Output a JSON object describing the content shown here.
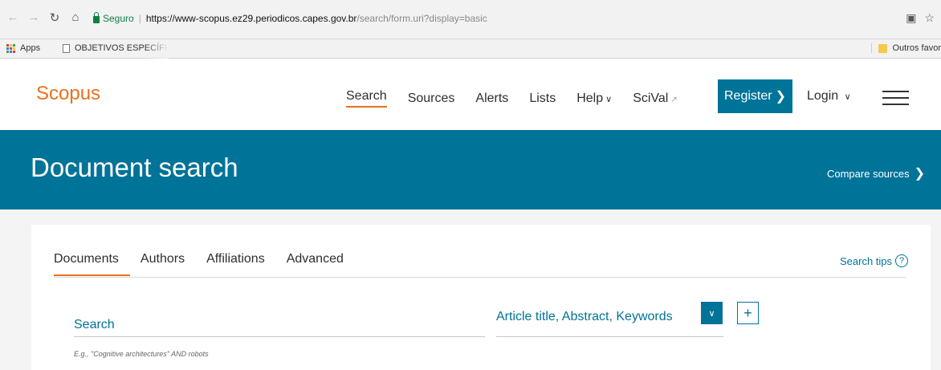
{
  "browser": {
    "secure_label": "Seguro",
    "url_host": "https://www-scopus.ez29.periodicos.capes.gov.br",
    "url_path": "/search/form.uri?display=basic",
    "bookmarks": {
      "apps": "Apps",
      "objetivos": "OBJETIVOS ESPECÍFI",
      "outros": "Outros favor"
    }
  },
  "header": {
    "logo": "Scopus",
    "nav": {
      "search": "Search",
      "sources": "Sources",
      "alerts": "Alerts",
      "lists": "Lists",
      "help": "Help",
      "scival": "SciVal"
    },
    "register": "Register",
    "login": "Login"
  },
  "banner": {
    "title": "Document search",
    "compare": "Compare sources"
  },
  "search": {
    "tabs": [
      "Documents",
      "Authors",
      "Affiliations",
      "Advanced"
    ],
    "tips": "Search tips",
    "placeholder": "Search",
    "hint": "E.g., \"Cognitive architectures\" AND robots",
    "field": "Article title, Abstract, Keywords"
  },
  "colors": {
    "accent": "#e9711c",
    "brand": "#007398"
  }
}
